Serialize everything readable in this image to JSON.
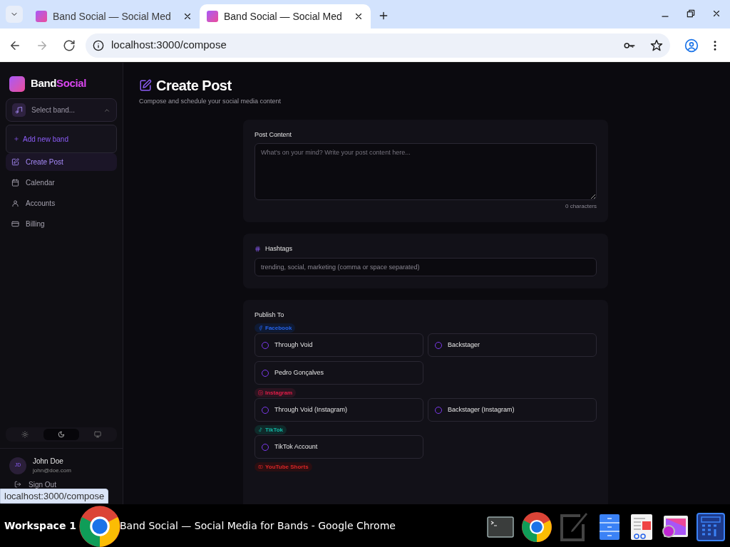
{
  "browser": {
    "tabs": [
      {
        "title": "Band Social — Social Med",
        "selected": false
      },
      {
        "title": "Band Social — Social Med",
        "selected": true
      }
    ],
    "address": "localhost:3000/compose"
  },
  "sidebar": {
    "brand": {
      "first": "Band",
      "second": "Social"
    },
    "band_select": {
      "placeholder": "Select band...",
      "expanded": true
    },
    "dropdown": {
      "items": [
        "Add new band"
      ]
    },
    "nav": [
      {
        "label": "Create Post",
        "selected": true
      },
      {
        "label": "Calendar",
        "selected": false
      },
      {
        "label": "Accounts",
        "selected": false
      },
      {
        "label": "Billing",
        "selected": false
      }
    ],
    "theme": [
      {
        "selected": false
      },
      {
        "selected": true
      },
      {
        "selected": false
      }
    ],
    "user": {
      "initials": "JD",
      "name": "John Doe",
      "email": "john@doe.com"
    },
    "sign_out": "Sign Out"
  },
  "main": {
    "title": "Create Post",
    "subtitle": "Compose and schedule your social media content",
    "post_content": {
      "label": "Post Content",
      "placeholder": "What's on your mind? Write your post content here...",
      "count": "0 characters"
    },
    "hashtags": {
      "label": "Hashtags",
      "placeholder": "trending, social, marketing (comma or space separated)"
    },
    "publish": {
      "label": "Publish To",
      "groups": [
        {
          "platform": "Facebook",
          "color": "#0f1a33",
          "accounts": [
            {
              "name": "Through Void",
              "checked": false
            },
            {
              "name": "Backstager",
              "checked": false
            },
            {
              "name": "Pedro Gonçalves",
              "checked": false
            }
          ]
        },
        {
          "platform": "Instagram",
          "color": "#2a1420",
          "accounts": [
            {
              "name": "Through Void (Instagram)",
              "checked": false
            },
            {
              "name": "Backstager (Instagram)",
              "checked": false
            }
          ]
        },
        {
          "platform": "TikTok",
          "color": "#0f2a2a",
          "accounts": [
            {
              "name": "TikTok Account",
              "checked": false
            }
          ]
        },
        {
          "platform": "YouTube Shorts",
          "color": "#2a0f12"
        }
      ]
    }
  },
  "status_url": "localhost:3000/compose",
  "taskbar": {
    "workspace": "Workspace 1",
    "window_title": "Band Social — Social Media for Bands - Google Chrome"
  }
}
